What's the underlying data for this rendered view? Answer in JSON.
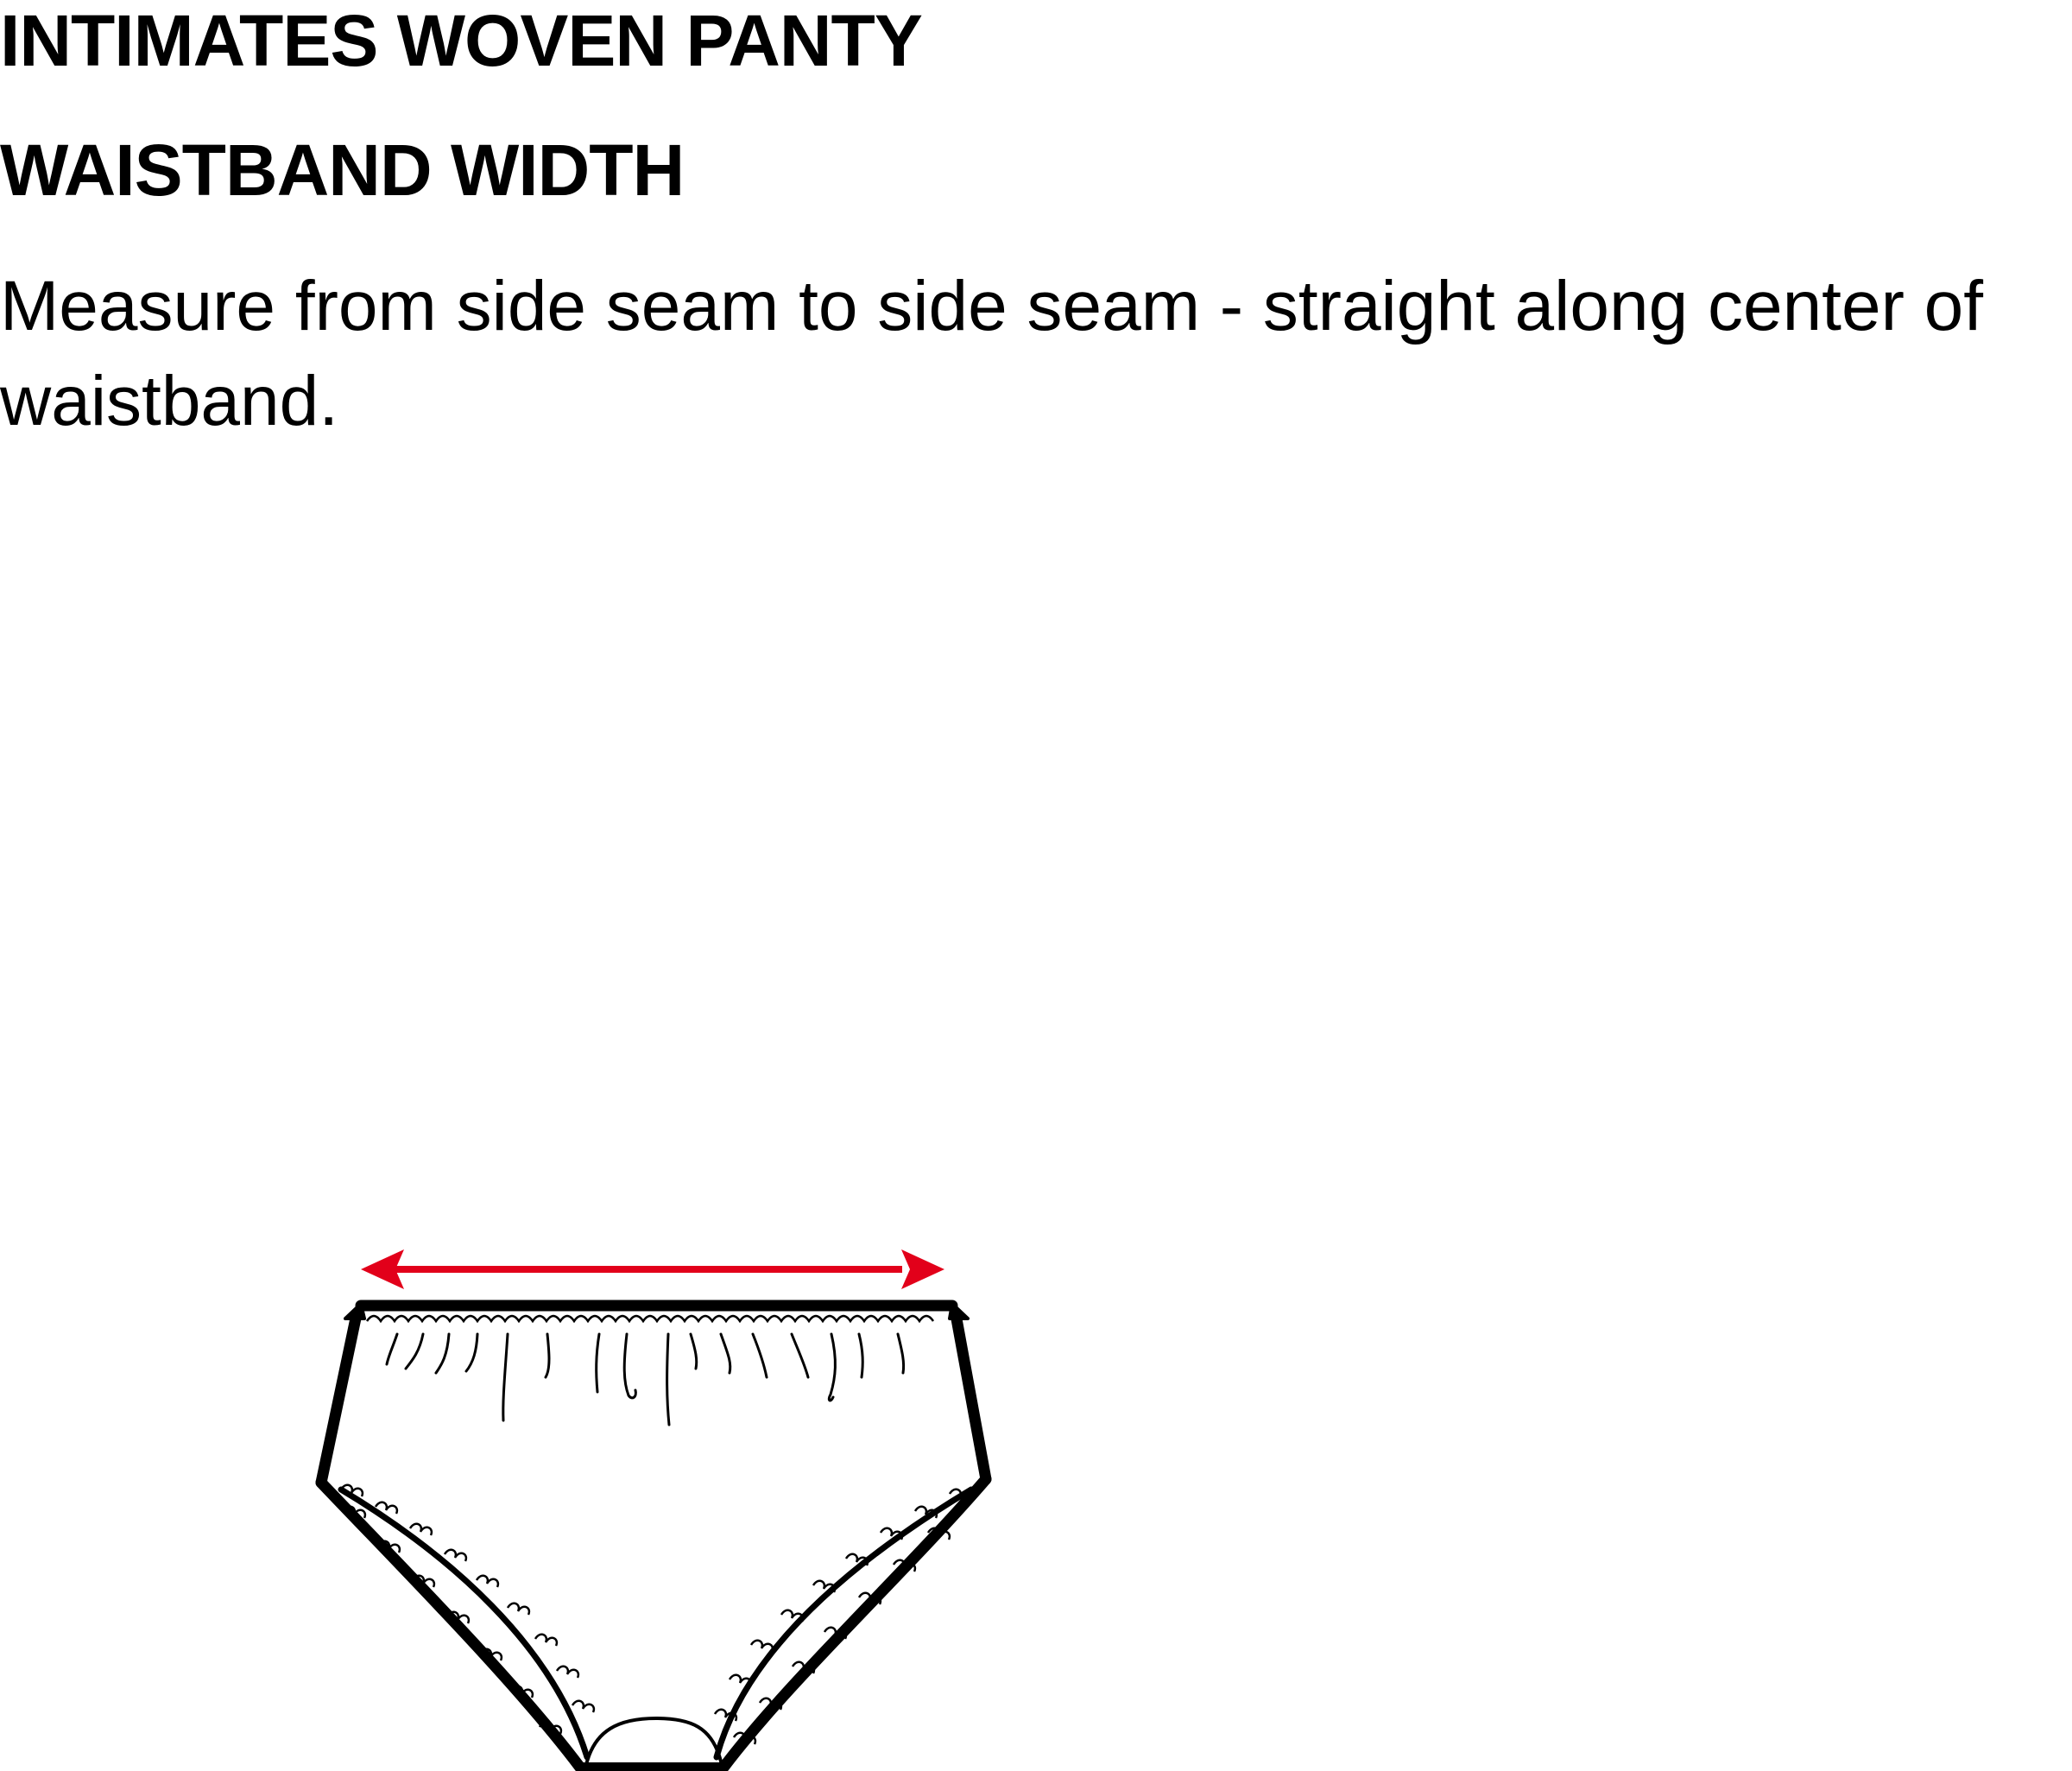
{
  "header": {
    "title": "INTIMATES WOVEN PANTY",
    "subtitle": "WAISTBAND WIDTH",
    "description": "Measure from side seam to side seam - straight along center of waistband."
  },
  "measurement": {
    "arrow_color": "#e2001a",
    "line_color": "#000000"
  }
}
